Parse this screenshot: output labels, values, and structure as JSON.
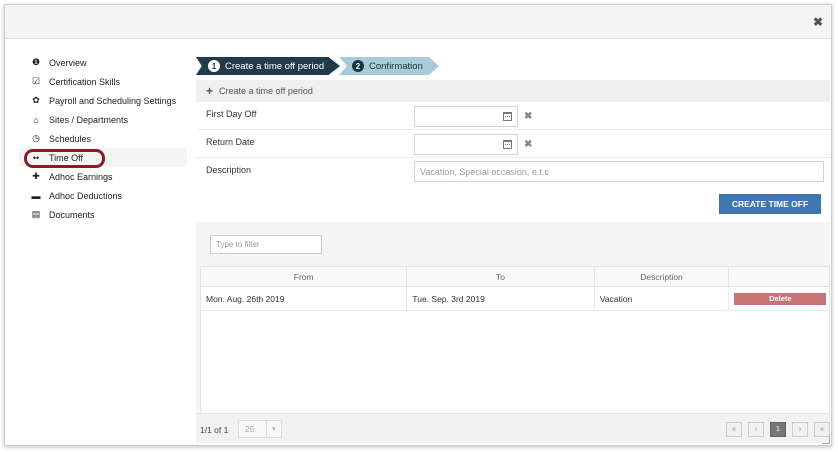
{
  "header": {
    "close_glyph": "✖"
  },
  "sidebar": {
    "items": [
      {
        "label": "Overview",
        "icon": "info-icon",
        "glyph": "❶"
      },
      {
        "label": "Certification Skills",
        "icon": "checkbox-icon",
        "glyph": "☑"
      },
      {
        "label": "Payroll and Scheduling Settings",
        "icon": "gear-icon",
        "glyph": "✿"
      },
      {
        "label": "Sites / Departments",
        "icon": "home-icon",
        "glyph": "⌂"
      },
      {
        "label": "Schedules",
        "icon": "clock-icon",
        "glyph": "◷"
      },
      {
        "label": "Time Off",
        "icon": "dots-icon",
        "glyph": "••"
      },
      {
        "label": "Adhoc Earnings",
        "icon": "plus-icon",
        "glyph": "✚"
      },
      {
        "label": "Adhoc Deductions",
        "icon": "minus-icon",
        "glyph": "▬"
      },
      {
        "label": "Documents",
        "icon": "document-icon",
        "glyph": "▤"
      }
    ],
    "active": "Time Off"
  },
  "wizard": {
    "steps": [
      {
        "num": "1",
        "label": "Create a time off period"
      },
      {
        "num": "2",
        "label": "Confirmation"
      }
    ]
  },
  "form": {
    "heading": "Create a time off period",
    "first_day_label": "First Day Off",
    "return_date_label": "Return Date",
    "description_label": "Description",
    "description_placeholder": "Vacation, Special occasion, e.t.c",
    "first_day_value": "",
    "return_date_value": "",
    "clear_glyph": "✖",
    "submit_label": "CREATE TIME OFF"
  },
  "table": {
    "filter_placeholder": "Type to filter",
    "columns": [
      "From",
      "To",
      "Description",
      ""
    ],
    "rows": [
      {
        "from": "Mon. Aug. 26th 2019",
        "to": "Tue. Sep. 3rd 2019",
        "description": "Vacation",
        "action": "Delete"
      }
    ]
  },
  "pagination": {
    "info": "1/1 of 1",
    "page_size": "25",
    "page_size_arrow": "▾",
    "buttons": [
      "«",
      "‹",
      "1",
      "›",
      "»"
    ],
    "current": "1"
  },
  "colors": {
    "step_active": "#1f3c48",
    "step_inactive": "#a9cbd5",
    "primary_button": "#3f78b0",
    "delete_button": "#c97474",
    "highlight_ring": "#8a1b2a"
  }
}
